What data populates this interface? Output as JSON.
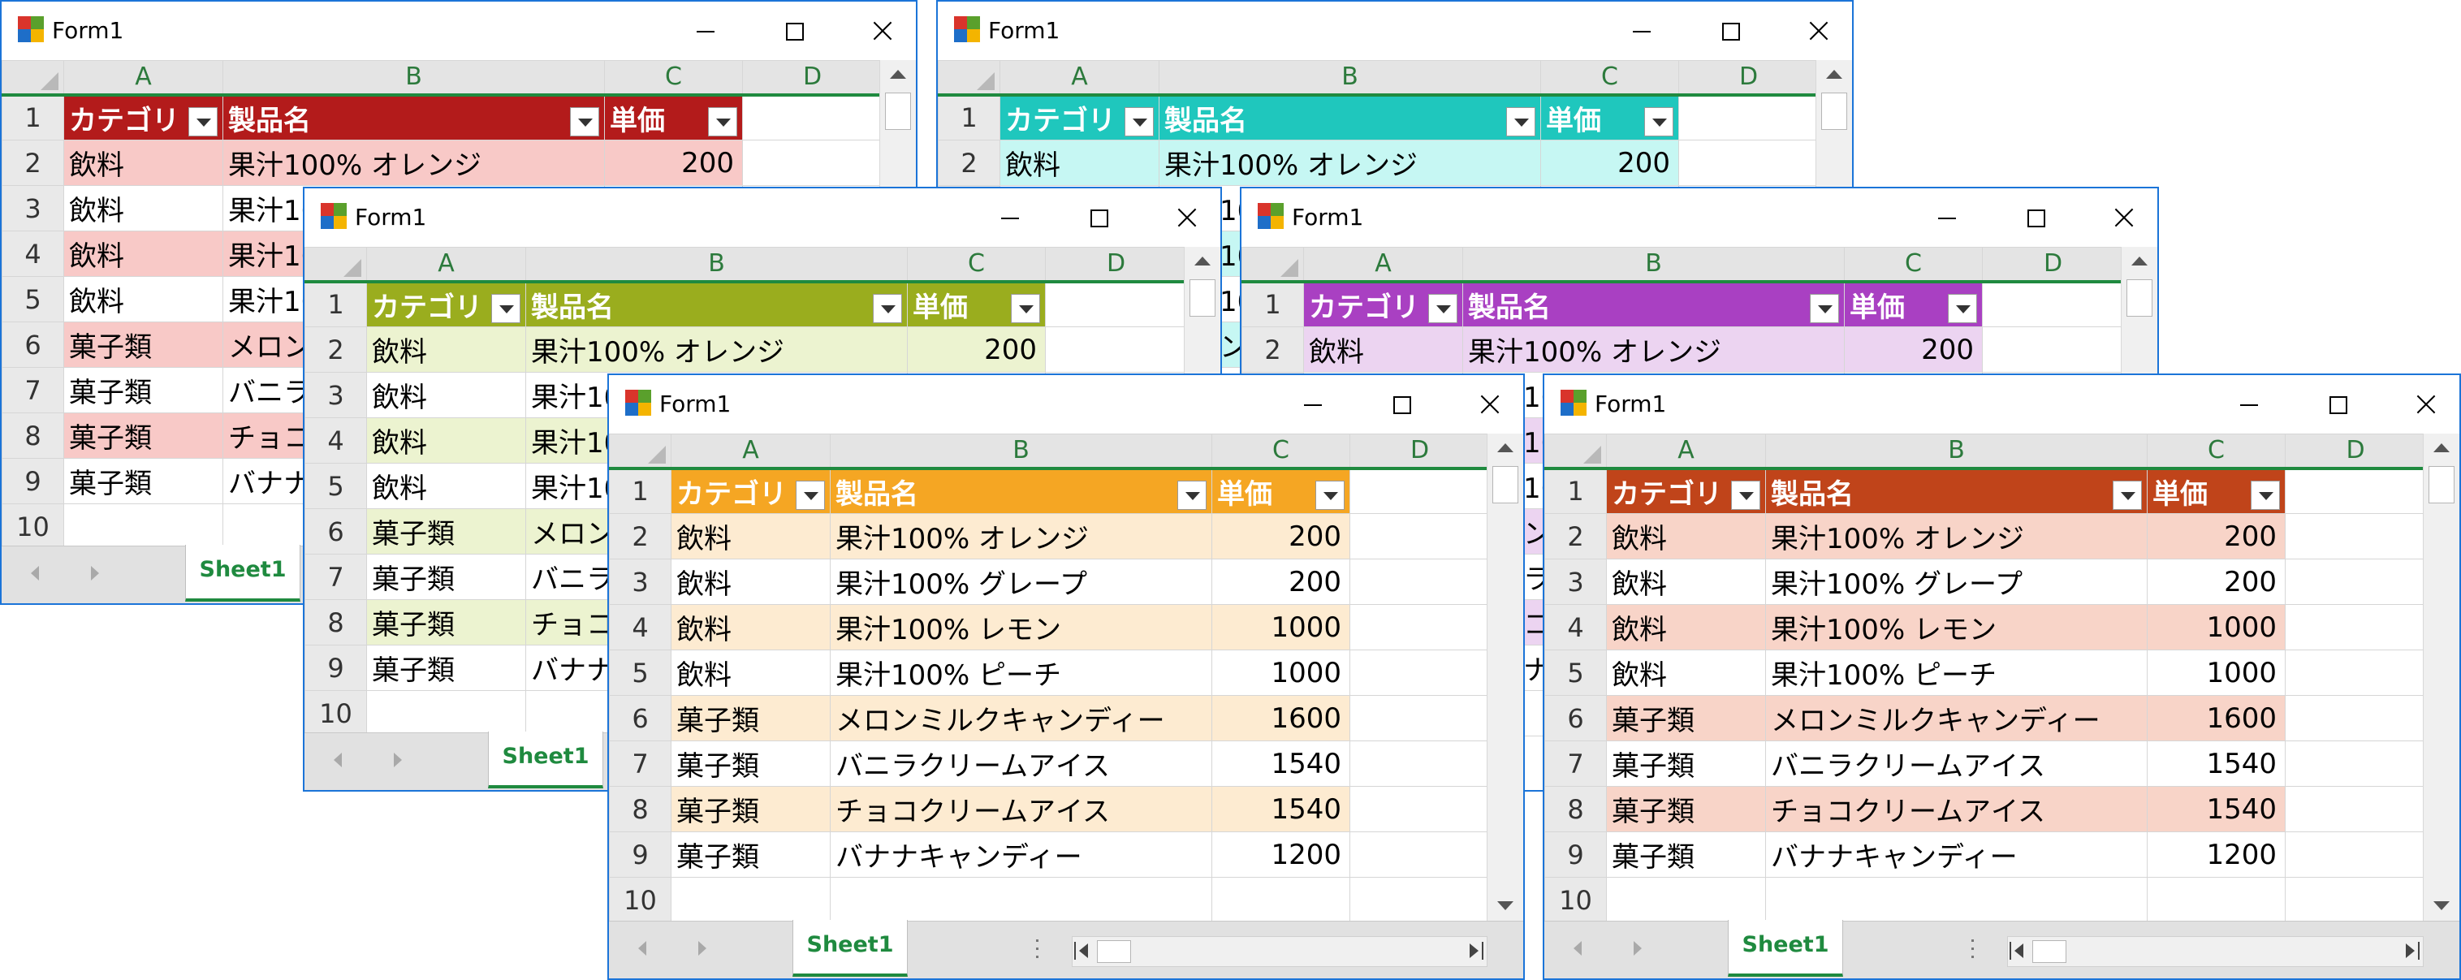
{
  "window_title": "Form1",
  "columns": [
    "A",
    "B",
    "C",
    "D"
  ],
  "row_numbers": [
    "1",
    "2",
    "3",
    "4",
    "5",
    "6",
    "7",
    "8",
    "9",
    "10"
  ],
  "headers": [
    "カテゴリ",
    "製品名",
    "単価"
  ],
  "rows": [
    {
      "category": "飲料",
      "product": "果汁100% オレンジ",
      "price": "200"
    },
    {
      "category": "飲料",
      "product": "果汁100% グレープ",
      "price": "200"
    },
    {
      "category": "飲料",
      "product": "果汁100% レモン",
      "price": "1000"
    },
    {
      "category": "飲料",
      "product": "果汁100% ピーチ",
      "price": "1000"
    },
    {
      "category": "菓子類",
      "product": "メロンミルクキャンディー",
      "price": "1600"
    },
    {
      "category": "菓子類",
      "product": "バニラクリームアイス",
      "price": "1540"
    },
    {
      "category": "菓子類",
      "product": "チョコクリームアイス",
      "price": "1540"
    },
    {
      "category": "菓子類",
      "product": "バナナキャンディー",
      "price": "1200"
    }
  ],
  "sheet_tab": "Sheet1",
  "windows": [
    {
      "id": "win1",
      "header_color": "#b31b1b",
      "band_color": "#f8c9c7"
    },
    {
      "id": "win2",
      "header_color": "#1fc7bd",
      "band_color": "#c6f7f3"
    },
    {
      "id": "win3",
      "header_color": "#9aad1e",
      "band_color": "#ecf3d0"
    },
    {
      "id": "win4",
      "header_color": "#a940c2",
      "band_color": "#ecd4f1"
    },
    {
      "id": "win5",
      "header_color": "#f5a623",
      "band_color": "#fdebd1"
    },
    {
      "id": "win6",
      "header_color": "#c0441a",
      "band_color": "#f8d4c8"
    }
  ]
}
